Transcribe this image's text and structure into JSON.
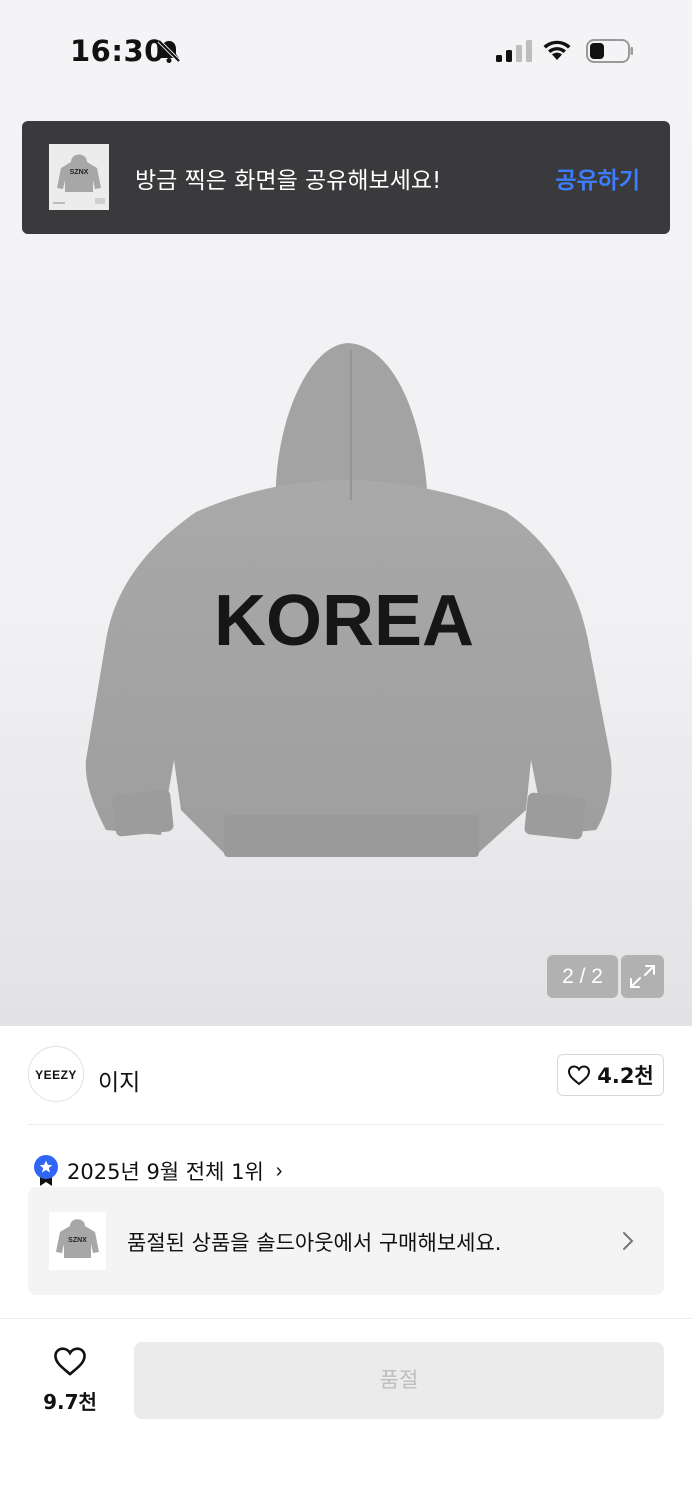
{
  "status_bar": {
    "time": "16:30",
    "icons": [
      "bell-off-icon",
      "cellular-signal-icon",
      "wifi-icon",
      "battery-icon"
    ]
  },
  "share_toast": {
    "message": "방금 찍은 화면을 공유해보세요!",
    "action_label": "공유하기",
    "action_color": "#3d7dff"
  },
  "product_image": {
    "print_text": "KOREA",
    "thumb_text": "SZNX",
    "page_indicator": "2 / 2"
  },
  "brand": {
    "logo_text": "YEEZY",
    "name": "이지",
    "like_count": "4.2천"
  },
  "ranking": {
    "text": "2025년 9월 전체 1위",
    "badge_color": "#2f66f5"
  },
  "sold_out_banner": {
    "text": "품절된 상품을 솔드아웃에서 구매해보세요."
  },
  "bottom_bar": {
    "wish_count": "9.7천",
    "purchase_label": "품절"
  }
}
